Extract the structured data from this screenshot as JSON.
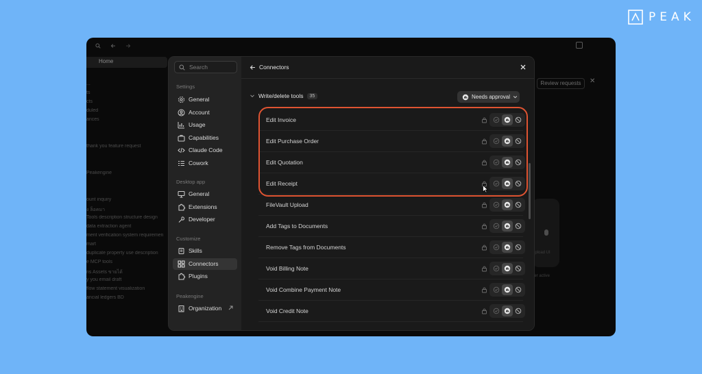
{
  "brand": {
    "name": "PEAK"
  },
  "background_app": {
    "home_label": "Home",
    "recent_items": [
      "...",
      "ts",
      "cts",
      "duled",
      "ances",
      "",
      "",
      "thank you feature request",
      "",
      "",
      "Peakengine",
      "",
      "",
      "ount inquiry",
      "ง ล็อคมา",
      "Tools description structure design",
      "data extraction agent",
      "ment verification system requiremen",
      "mart",
      "duplicate property use description",
      "e MCP tools",
      "ns Assets ขายได้",
      "y you email draft",
      "flow statement visualization",
      "ancial ledgers BD"
    ],
    "review_button": "Review requests",
    "side_text_1": "Upload UI",
    "side_text_2": "der active"
  },
  "sidebar": {
    "search_placeholder": "Search",
    "settings_label": "Settings",
    "settings_items": [
      {
        "label": "General",
        "icon": "gear-icon"
      },
      {
        "label": "Account",
        "icon": "user-icon"
      },
      {
        "label": "Usage",
        "icon": "chart-icon"
      },
      {
        "label": "Capabilities",
        "icon": "briefcase-icon"
      },
      {
        "label": "Claude Code",
        "icon": "code-icon"
      },
      {
        "label": "Cowork",
        "icon": "checklist-icon"
      }
    ],
    "desktop_label": "Desktop app",
    "desktop_items": [
      {
        "label": "General",
        "icon": "monitor-icon"
      },
      {
        "label": "Extensions",
        "icon": "puzzle-icon"
      },
      {
        "label": "Developer",
        "icon": "wrench-icon"
      }
    ],
    "customize_label": "Customize",
    "customize_items": [
      {
        "label": "Skills",
        "icon": "scroll-icon"
      },
      {
        "label": "Connectors",
        "icon": "grid-icon",
        "active": true
      },
      {
        "label": "Plugins",
        "icon": "puzzle-icon"
      }
    ],
    "org_section_label": "Peakengine",
    "org_items": [
      {
        "label": "Organization",
        "icon": "building-icon"
      }
    ]
  },
  "main": {
    "header_title": "Connectors",
    "group_title": "Write/delete tools",
    "group_count": "35",
    "approval_label": "Needs approval",
    "tools": [
      "Edit Invoice",
      "Edit Purchase Order",
      "Edit Quotation",
      "Edit Receipt",
      "FileVault Upload",
      "Add Tags to Documents",
      "Remove Tags from Documents",
      "Void Billing Note",
      "Void Combine Payment Note",
      "Void Credit Note"
    ],
    "selected_permission": "needs-approval"
  },
  "colors": {
    "page_background": "#6fb4f8",
    "highlight": "#e05432",
    "modal_background": "#1a1a1a"
  }
}
